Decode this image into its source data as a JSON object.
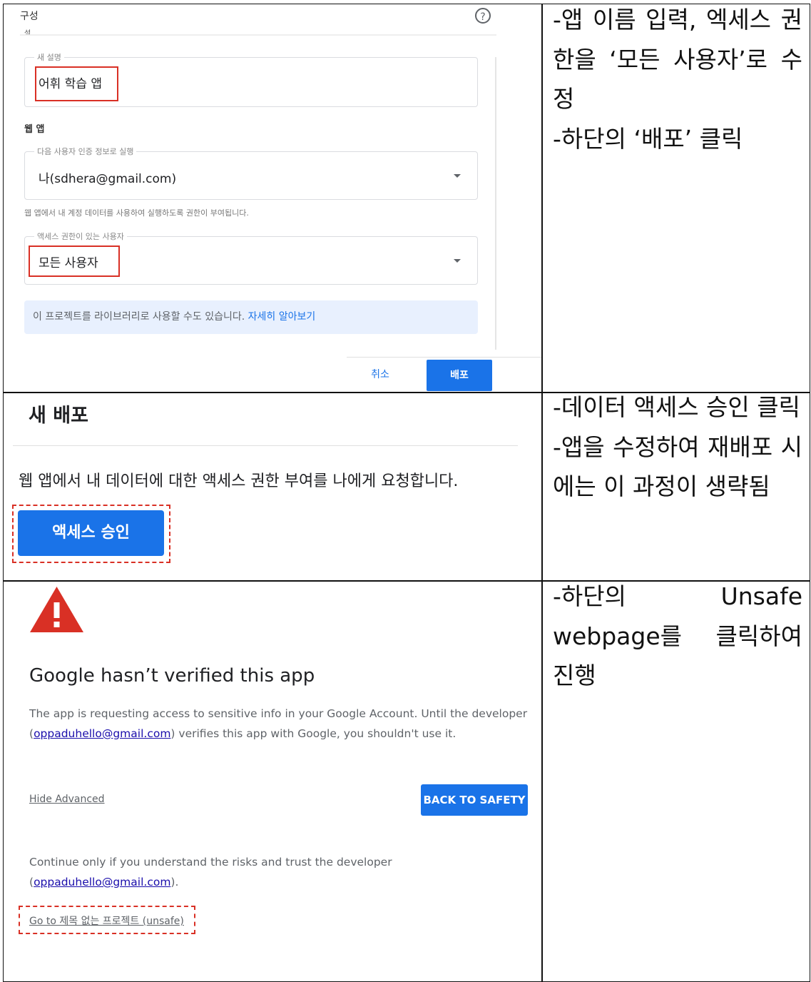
{
  "notes": {
    "row1": [
      "-앱 이름 입력, 엑세스 권한을 ‘모든 사용자’로 수정",
      "-하단의 ‘배포’ 클릭"
    ],
    "row2": [
      "-데이터 액세스 승인 클릭",
      "-앱을 수정하여 재배포 시에는 이 과정이 생략됨"
    ],
    "row3": [
      "-하단의 Unsafe webpage를 클릭하여 진행"
    ]
  },
  "config_dialog": {
    "title": "구성",
    "cut_label": "설명",
    "desc_legend": "새 설명",
    "desc_value": "어휘 학습 앱",
    "webapp_heading": "웹 앱",
    "exec_legend": "다음 사용자 인증 정보로 실행",
    "exec_value": "나(sdhera@gmail.com)",
    "exec_hint": "웹 앱에서 내 계정 데이터를 사용하여 실행하도록 권한이 부여됩니다.",
    "access_legend": "액세스 권한이 있는 사용자",
    "access_value": "모든 사용자",
    "info_text": "이 프로젝트를 라이브러리로 사용할 수도 있습니다.",
    "info_link": "자세히 알아보기",
    "cancel_label": "취소",
    "deploy_label": "배포"
  },
  "new_deploy": {
    "title": "새 배포",
    "message": "웹 앱에서 내 데이터에 대한 액세스 권한 부여를 나에게 요청합니다.",
    "approve_label": "액세스 승인"
  },
  "warning": {
    "title": "Google hasn’t verified this app",
    "body_1": "The app is requesting access to sensitive info in your Google Account. Until the developer",
    "body_email": "oppaduhello@gmail.com",
    "body_2": " verifies this app with Google, you shouldn't use it.",
    "hide_advanced": "Hide Advanced",
    "back_to_safety": "BACK TO SAFETY",
    "continue_text": "Continue only if you understand the risks and trust the developer",
    "continue_email": "oppaduhello@gmail.com",
    "go_to_link": "Go to 제목 없는 프로젝트 (unsafe)",
    "colors": {
      "warning_red": "#d93025",
      "button_blue": "#1a73e8"
    }
  }
}
